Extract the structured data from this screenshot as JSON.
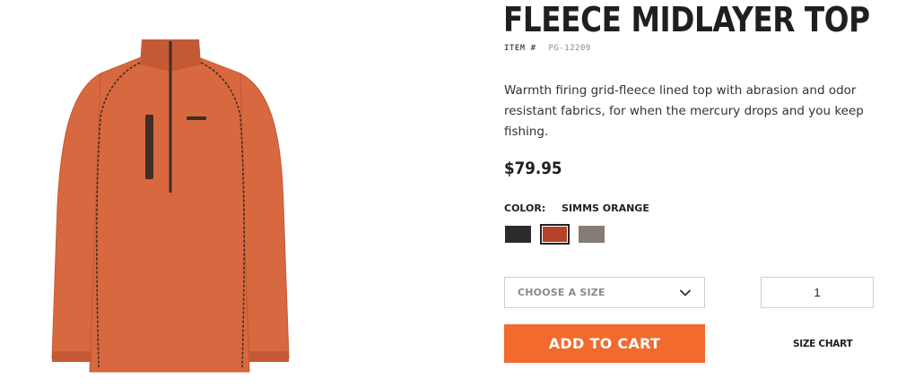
{
  "product": {
    "title": "FLEECE MIDLAYER TOP",
    "item_label": "ITEM #",
    "item_number": "PG-12209",
    "description": "Warmth firing grid-fleece lined top with abrasion and odor resistant fabrics, for when the mercury drops and you keep fishing.",
    "price": "$79.95"
  },
  "color": {
    "label": "COLOR:",
    "selected_name": "SIMMS ORANGE",
    "swatches": [
      {
        "name": "black",
        "hex": "#2b2b2b",
        "selected": false
      },
      {
        "name": "simms-orange",
        "hex": "#b5432a",
        "selected": true
      },
      {
        "name": "gray",
        "hex": "#847c74",
        "selected": false
      }
    ]
  },
  "size": {
    "placeholder": "CHOOSE A SIZE"
  },
  "quantity": {
    "value": "1"
  },
  "actions": {
    "add_to_cart_label": "ADD TO CART",
    "add_to_cart_color": "#f26a2e",
    "size_chart_label": "SIZE CHART"
  },
  "image": {
    "garment_color": "#d8683f",
    "garment_shade": "#c45a35",
    "trim_color": "#3e2e25"
  }
}
